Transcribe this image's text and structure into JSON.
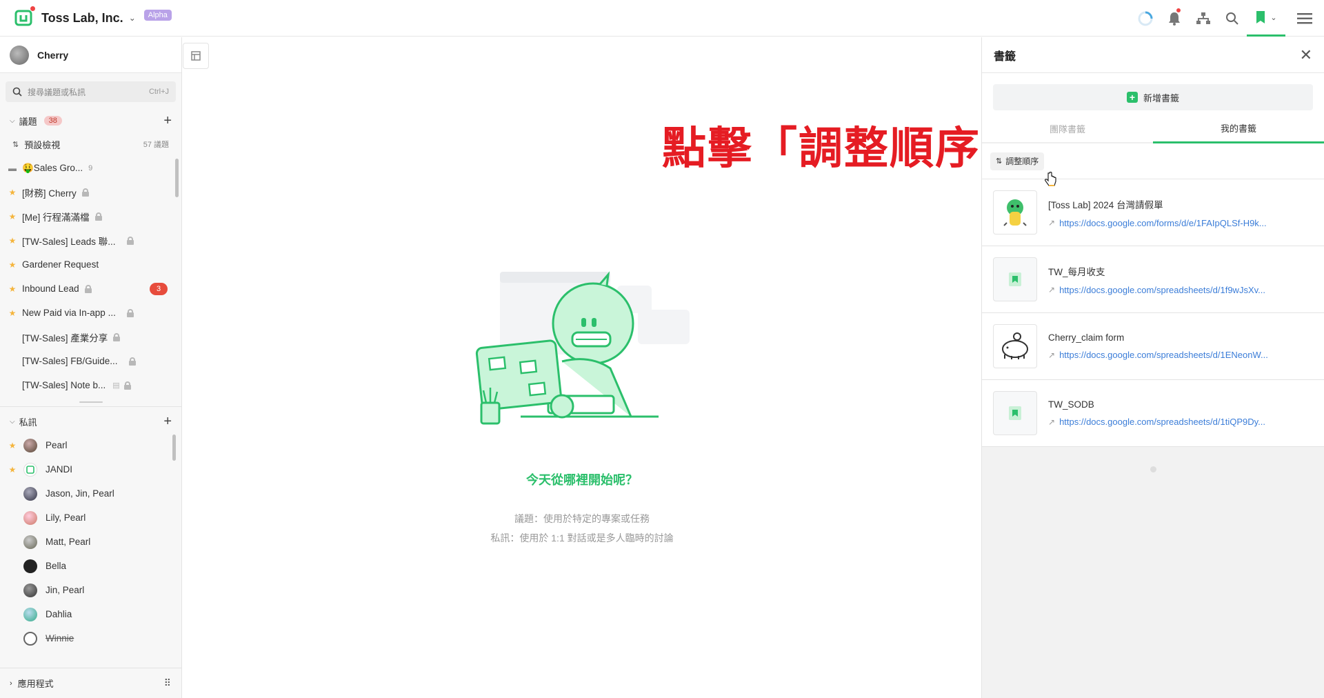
{
  "header": {
    "team_name": "Toss Lab, Inc.",
    "badge": "Alpha"
  },
  "sidebar": {
    "user_name": "Cherry",
    "search": {
      "placeholder": "搜尋議題或私訊",
      "shortcut": "Ctrl+J"
    },
    "topics": {
      "title": "議題",
      "count": "38",
      "default_view": {
        "label": "預設檢視",
        "count": "57 議題"
      },
      "items": [
        {
          "label": "🤑Sales Gro...",
          "sub": "9"
        },
        {
          "label": "[財務] Cherry"
        },
        {
          "label": "[Me] 行程滿滿檔"
        },
        {
          "label": "[TW-Sales] Leads 聯..."
        },
        {
          "label": "Gardener Request"
        },
        {
          "label": "Inbound Lead",
          "unread": "3"
        },
        {
          "label": "New Paid via In-app ..."
        },
        {
          "label": "[TW-Sales] 產業分享"
        },
        {
          "label": "[TW-Sales] FB/Guide..."
        },
        {
          "label": "[TW-Sales] Note b..."
        }
      ]
    },
    "dms": {
      "title": "私訊",
      "items": [
        {
          "label": "Pearl"
        },
        {
          "label": "JANDI"
        },
        {
          "label": "Jason, Jin, Pearl"
        },
        {
          "label": "Lily, Pearl"
        },
        {
          "label": "Matt, Pearl"
        },
        {
          "label": "Bella"
        },
        {
          "label": "Jin, Pearl"
        },
        {
          "label": "Dahlia"
        },
        {
          "label": "Winnie"
        }
      ]
    },
    "apps_label": "應用程式"
  },
  "main": {
    "overlay_instruction": "點擊「調整順序」",
    "welcome_title": "今天從哪裡開始呢？",
    "welcome_line1": "議題：使用於特定的專案或任務",
    "welcome_line2": "私訊：使用於 1:1 對話或是多人臨時的討論"
  },
  "bookmarks": {
    "title": "書籤",
    "add_label": "新增書籤",
    "tabs": [
      "團隊書籤",
      "我的書籤"
    ],
    "reorder_label": "調整順序",
    "items": [
      {
        "name": "[Toss Lab] 2024 台灣請假單",
        "url": "https://docs.google.com/forms/d/e/1FAIpQLSf-H9k..."
      },
      {
        "name": "TW_每月收支",
        "url": "https://docs.google.com/spreadsheets/d/1f9wJsXv..."
      },
      {
        "name": "Cherry_claim form",
        "url": "https://docs.google.com/spreadsheets/d/1ENeonW..."
      },
      {
        "name": "TW_SODB",
        "url": "https://docs.google.com/spreadsheets/d/1tiQP9Dy..."
      }
    ]
  },
  "colors": {
    "accent": "#2bbf6b",
    "alert": "#e74c3c",
    "link": "#3b7dd8",
    "overlay": "#e51c23"
  }
}
